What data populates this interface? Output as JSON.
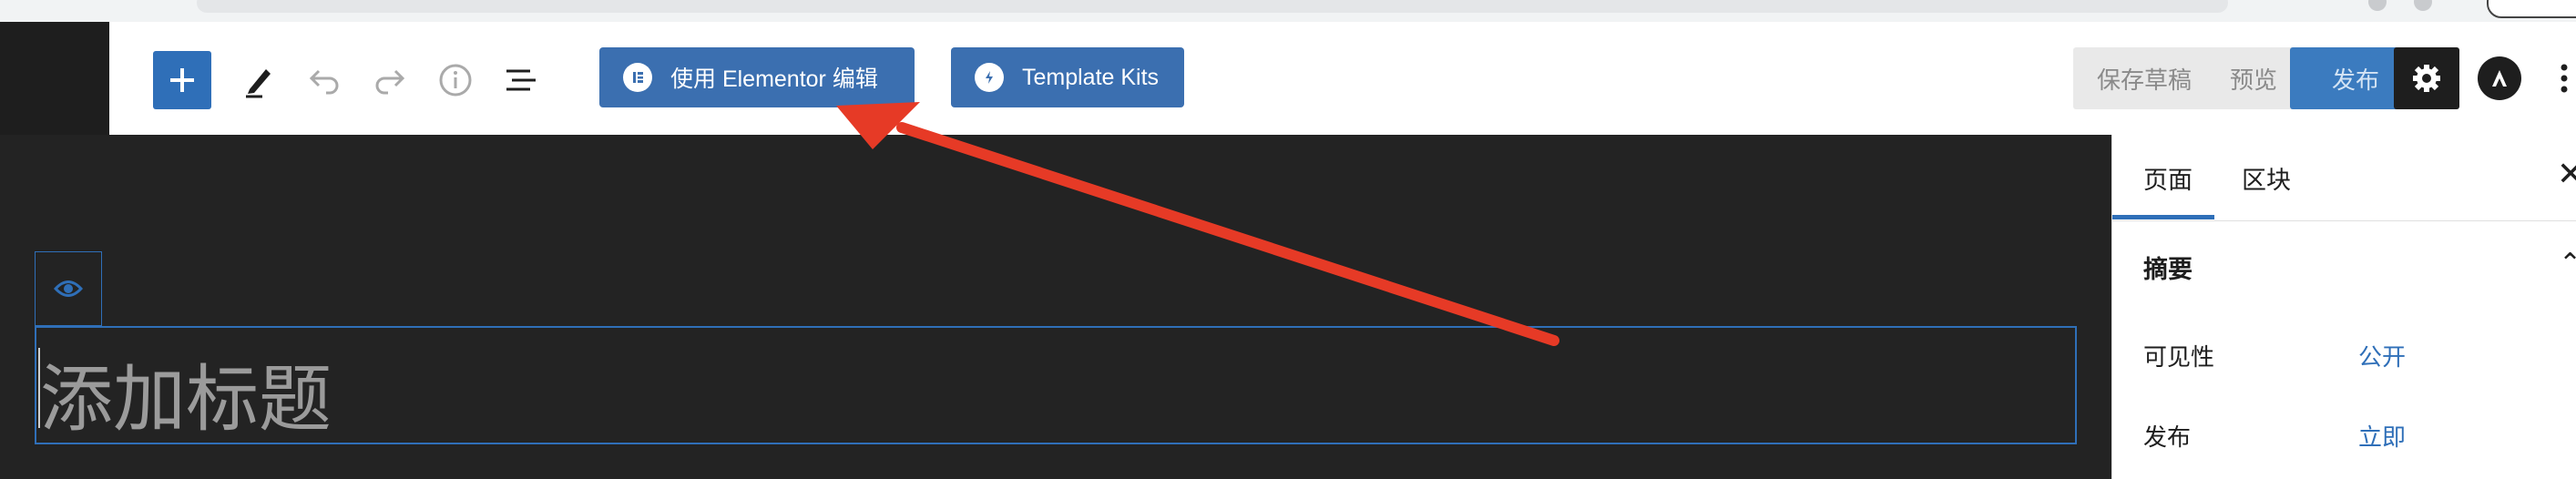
{
  "toolbar": {
    "elementor_button": "使用 Elementor 编辑",
    "template_kits_button": "Template Kits",
    "save_draft": "保存草稿",
    "preview": "预览",
    "publish": "发布"
  },
  "editor": {
    "title_placeholder": "添加标题"
  },
  "sidebar": {
    "tabs": [
      "页面",
      "区块"
    ],
    "section_title": "摘要",
    "rows": [
      {
        "label": "可见性",
        "value": "公开"
      },
      {
        "label": "发布",
        "value": "立即"
      }
    ]
  },
  "colors": {
    "accent": "#2f6fb8",
    "annotation_arrow": "#e63a26",
    "canvas_bg": "#232323"
  },
  "icons": [
    "plus-icon",
    "pen-icon",
    "undo-icon",
    "redo-icon",
    "info-icon",
    "list-view-icon",
    "elementor-icon",
    "template-kits-icon",
    "gear-icon",
    "astra-icon",
    "kebab-icon",
    "eye-icon",
    "close-icon",
    "chevron-up-icon"
  ]
}
